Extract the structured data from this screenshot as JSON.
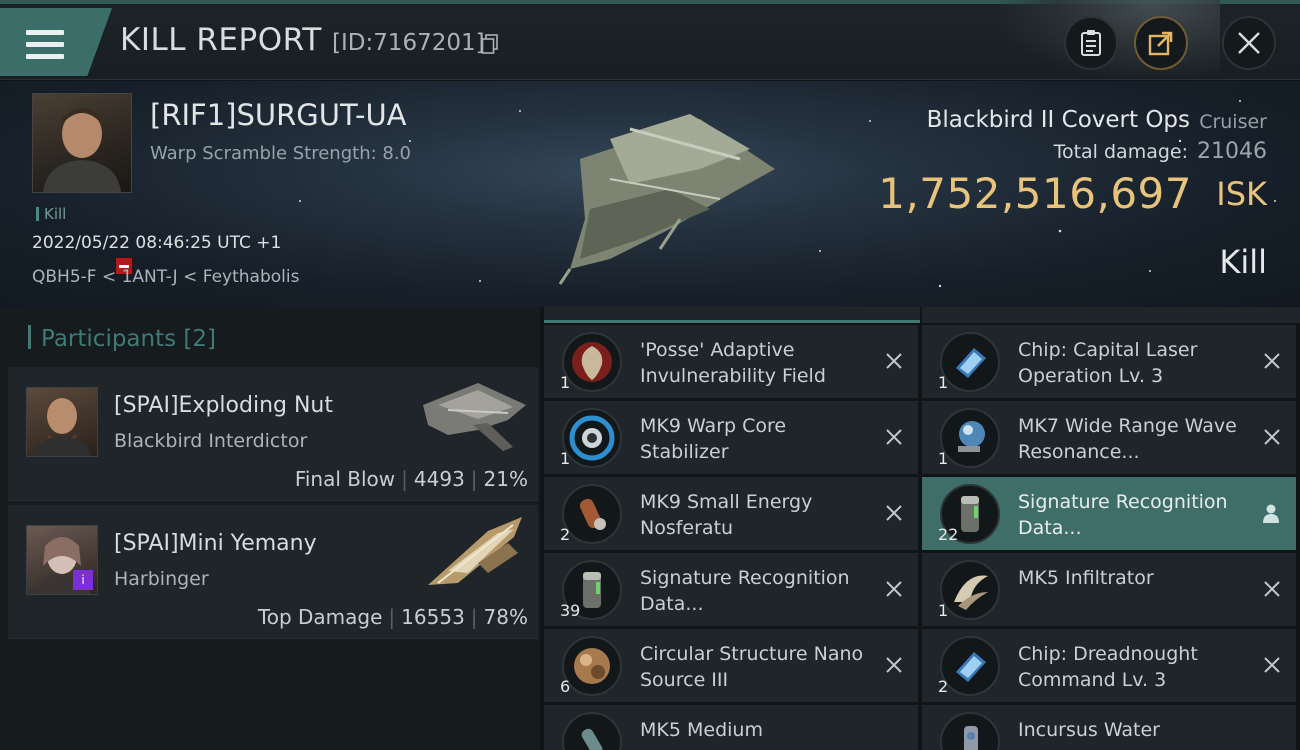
{
  "header": {
    "title": "KILL REPORT",
    "report_id": "[ID:7167201]"
  },
  "victim": {
    "name": "[RIF1]SURGUT-UA",
    "warp_scramble": "Warp Scramble Strength: 8.0",
    "tag": "Kill",
    "datetime": "2022/05/22 08:46:25 UTC +1",
    "location": "QBH5-F < 1ANT-J < Feythabolis",
    "ship_name": "Blackbird II Covert Ops",
    "ship_class": "Cruiser",
    "total_damage_label": "Total damage:",
    "total_damage": "21046",
    "isk_value": "1,752,516,697",
    "isk_unit": "ISK",
    "result": "Kill"
  },
  "participants": {
    "title": "Participants",
    "count": "[2]",
    "list": [
      {
        "name": "[SPAI]Exploding Nut",
        "ship": "Blackbird Interdictor",
        "role": "Final Blow",
        "damage": "4493",
        "percent": "21%"
      },
      {
        "name": "[SPAI]Mini Yemany",
        "ship": "Harbinger",
        "role": "Top Damage",
        "damage": "16553",
        "percent": "78%"
      }
    ]
  },
  "items_left": [
    {
      "qty": "1",
      "name": "'Posse' Adaptive Invulnerability Field",
      "icon": "shield-module-icon"
    },
    {
      "qty": "1",
      "name": "MK9 Warp Core Stabilizer",
      "icon": "warp-core-icon"
    },
    {
      "qty": "2",
      "name": "MK9 Small Energy Nosferatu",
      "icon": "nosferatu-icon"
    },
    {
      "qty": "39",
      "name": "Signature Recognition Data...",
      "icon": "data-canister-icon"
    },
    {
      "qty": "6",
      "name": "Circular Structure Nano Source III",
      "icon": "nano-source-icon"
    },
    {
      "qty": "",
      "name": "MK5 Medium",
      "icon": "module-icon"
    }
  ],
  "items_right": [
    {
      "qty": "1",
      "name": "Chip: Capital Laser Operation Lv. 3",
      "icon": "chip-icon"
    },
    {
      "qty": "1",
      "name": "MK7 Wide Range Wave Resonance...",
      "icon": "resonance-icon"
    },
    {
      "qty": "22",
      "name": "Signature Recognition Data...",
      "icon": "data-canister-icon"
    },
    {
      "qty": "1",
      "name": "MK5  Infiltrator",
      "icon": "infiltrator-drone-icon"
    },
    {
      "qty": "2",
      "name": "Chip: Dreadnought Command Lv. 3",
      "icon": "chip-icon"
    },
    {
      "qty": "",
      "name": "Incursus Water",
      "icon": "incursus-icon"
    }
  ],
  "colors": {
    "accent_teal": "#3f6e69",
    "isk_gold": "#e8c37c",
    "highlight_row": "#3f6e69"
  }
}
